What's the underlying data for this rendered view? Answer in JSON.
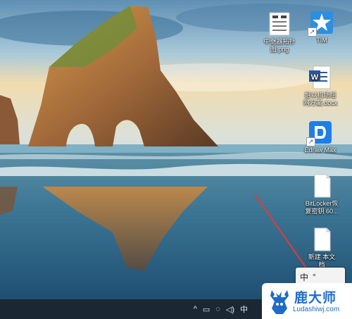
{
  "desktop": {
    "icons": [
      {
        "name": "中继器拓扑图.png",
        "label": "中继器拓扑\n图.png",
        "type": "image"
      },
      {
        "name": "TIM",
        "label": "TIM",
        "type": "app"
      },
      {
        "name": "组网方案.docx",
        "label": "姐以机场组\n网方案.docx",
        "type": "word"
      },
      {
        "name": "Edraw Max",
        "label": "Edraw Max",
        "type": "app"
      },
      {
        "name": "BitLocker恢复密钥",
        "label": "BitLocker恢\n复密钥 60...",
        "type": "file"
      },
      {
        "name": "新建文本文档",
        "label": "新建 本文\n档",
        "type": "file"
      }
    ]
  },
  "taskbar": {
    "tray_symbols": [
      "^",
      "▭",
      "◌",
      "◁)",
      "中"
    ],
    "ime_float": [
      "中",
      "°"
    ]
  },
  "watermark": {
    "title": "鹿大师",
    "url": "Ludashiwj.com"
  },
  "colors": {
    "taskbar": "#1b2733",
    "accent": "#1f6cc8"
  }
}
